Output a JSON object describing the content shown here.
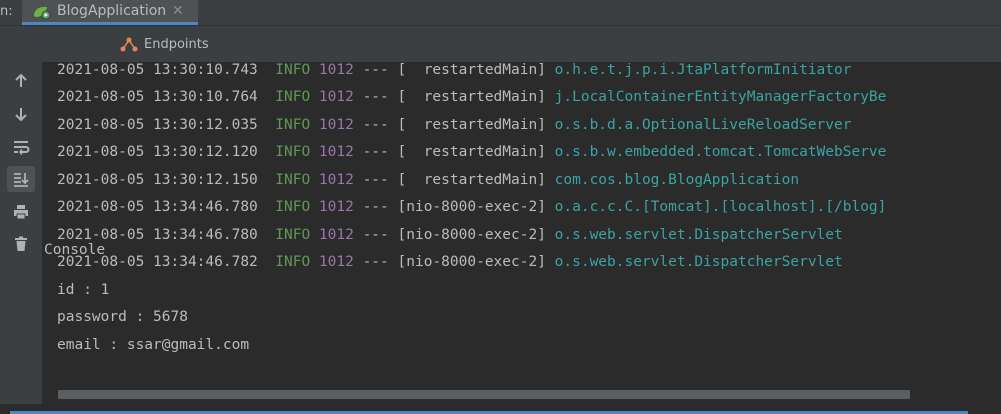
{
  "run": {
    "prefix": "n:",
    "tab_label": "BlogApplication",
    "close_glyph": "✕"
  },
  "subtabs": [
    {
      "label": "Console",
      "icon": "console-icon"
    },
    {
      "label": "Endpoints",
      "icon": "endpoints-icon"
    }
  ],
  "toolbar": {
    "icons": [
      "arrow-up-icon",
      "arrow-down-icon",
      "soft-wrap-icon",
      "scroll-to-end-icon",
      "print-icon",
      "trash-icon"
    ]
  },
  "colors": {
    "background": "#2b2b2b",
    "info": "#629755",
    "pid": "#9876aa",
    "logger": "#3aa3a3",
    "text": "#bbbbbb"
  },
  "log": [
    {
      "ts": "2021-08-05 13:30:10.743",
      "level": "INFO",
      "pid": "1012",
      "sep": "---",
      "thread": "[  restartedMain]",
      "logger": "o.h.e.t.j.p.i.JtaPlatformInitiator"
    },
    {
      "ts": "2021-08-05 13:30:10.764",
      "level": "INFO",
      "pid": "1012",
      "sep": "---",
      "thread": "[  restartedMain]",
      "logger": "j.LocalContainerEntityManagerFactoryBe"
    },
    {
      "ts": "2021-08-05 13:30:12.035",
      "level": "INFO",
      "pid": "1012",
      "sep": "---",
      "thread": "[  restartedMain]",
      "logger": "o.s.b.d.a.OptionalLiveReloadServer"
    },
    {
      "ts": "2021-08-05 13:30:12.120",
      "level": "INFO",
      "pid": "1012",
      "sep": "---",
      "thread": "[  restartedMain]",
      "logger": "o.s.b.w.embedded.tomcat.TomcatWebServe"
    },
    {
      "ts": "2021-08-05 13:30:12.150",
      "level": "INFO",
      "pid": "1012",
      "sep": "---",
      "thread": "[  restartedMain]",
      "logger": "com.cos.blog.BlogApplication"
    },
    {
      "ts": "2021-08-05 13:34:46.780",
      "level": "INFO",
      "pid": "1012",
      "sep": "---",
      "thread": "[nio-8000-exec-2]",
      "logger": "o.a.c.c.C.[Tomcat].[localhost].[/blog]"
    },
    {
      "ts": "2021-08-05 13:34:46.780",
      "level": "INFO",
      "pid": "1012",
      "sep": "---",
      "thread": "[nio-8000-exec-2]",
      "logger": "o.s.web.servlet.DispatcherServlet"
    },
    {
      "ts": "2021-08-05 13:34:46.782",
      "level": "INFO",
      "pid": "1012",
      "sep": "---",
      "thread": "[nio-8000-exec-2]",
      "logger": "o.s.web.servlet.DispatcherServlet"
    }
  ],
  "output": [
    "id : 1",
    "password : 5678",
    "email : ssar@gmail.com"
  ]
}
